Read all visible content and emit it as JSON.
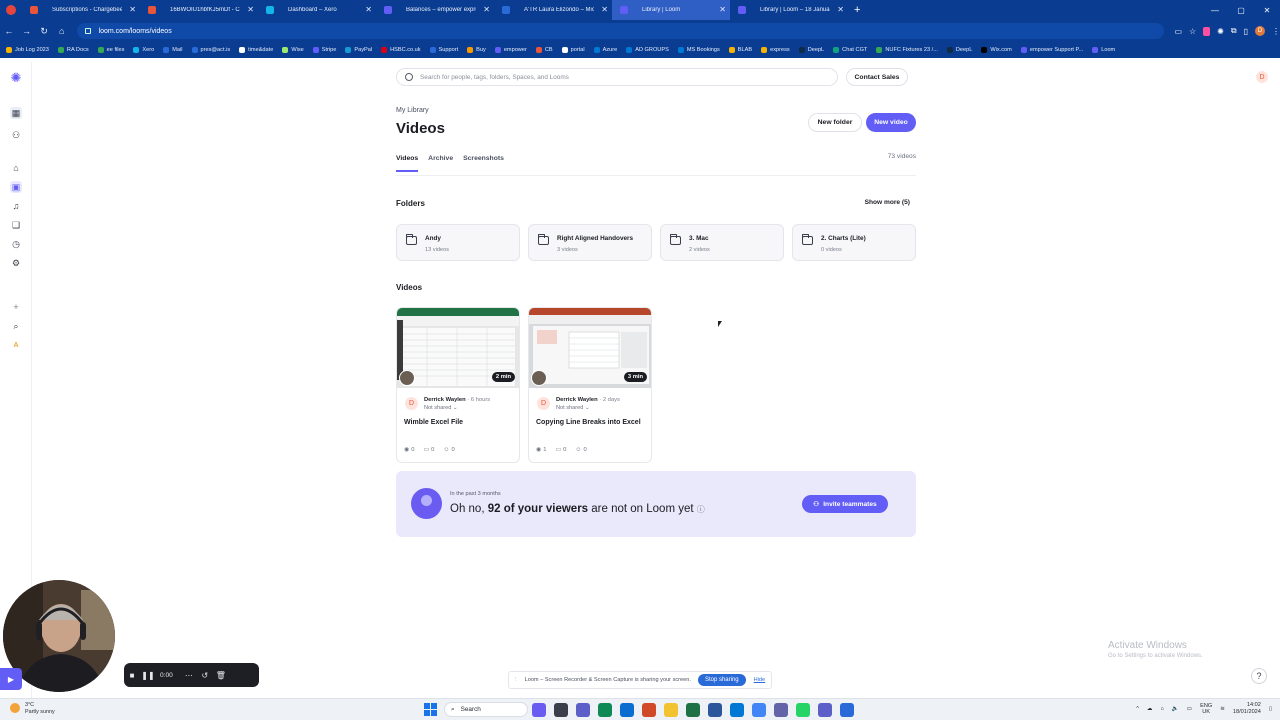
{
  "browser": {
    "tabs": [
      {
        "label": "Subscriptions - Chargebee",
        "color": "#e8553b"
      },
      {
        "label": "16BWOIU1hbfKJ5mDf - Custon",
        "color": "#e8553b"
      },
      {
        "label": "Dashboard – Xero",
        "color": "#13b5ea"
      },
      {
        "label": "Balances – empower express –",
        "color": "#625df5"
      },
      {
        "label": "A'TR Laura Elizondo – Microsoft",
        "color": "#2a6ad8"
      },
      {
        "label": "Library | Loom",
        "color": "#625df5",
        "active": true
      },
      {
        "label": "Library | Loom – 18 January 20",
        "color": "#625df5"
      }
    ],
    "url": "loom.com/looms/videos",
    "bookmarks": [
      {
        "label": "Job Log 2023",
        "color": "#f4b400"
      },
      {
        "label": "RA Docs",
        "color": "#34a853"
      },
      {
        "label": "ee files",
        "color": "#34a853"
      },
      {
        "label": "Xero",
        "color": "#13b5ea"
      },
      {
        "label": "Mail",
        "color": "#2a6ad8"
      },
      {
        "label": "pres@act.is",
        "color": "#2a6ad8"
      },
      {
        "label": "time&date",
        "color": "#ffffff"
      },
      {
        "label": "Wise",
        "color": "#9fe870"
      },
      {
        "label": "Stripe",
        "color": "#635bff"
      },
      {
        "label": "PayPal",
        "color": "#169bd7"
      },
      {
        "label": "HSBC.co.uk",
        "color": "#db0011"
      },
      {
        "label": "Support",
        "color": "#2a6ad8"
      },
      {
        "label": "Buy",
        "color": "#ff9900"
      },
      {
        "label": "empower",
        "color": "#625df5"
      },
      {
        "label": "CB",
        "color": "#e8553b"
      },
      {
        "label": "portal",
        "color": "#ffffff"
      },
      {
        "label": "Azure",
        "color": "#0078d4"
      },
      {
        "label": "AD GROUPS",
        "color": "#0078d4"
      },
      {
        "label": "MS Bookings",
        "color": "#0078d4"
      },
      {
        "label": "BLAB",
        "color": "#f4b400"
      },
      {
        "label": "express",
        "color": "#f4b400"
      },
      {
        "label": "DeepL",
        "color": "#0f2b46"
      },
      {
        "label": "Chat CGT",
        "color": "#10a37f"
      },
      {
        "label": "NUFC Fixtures 23 /...",
        "color": "#34a853"
      },
      {
        "label": "DeepL",
        "color": "#0f2b46"
      },
      {
        "label": "Wix.com",
        "color": "#000000"
      },
      {
        "label": "empower Support P...",
        "color": "#625df5"
      },
      {
        "label": "Loom",
        "color": "#625df5"
      }
    ]
  },
  "loom": {
    "search_placeholder": "Search for people, tags, folders, Spaces, and Looms",
    "contact_sales": "Contact Sales",
    "avatar_initial": "D",
    "breadcrumb": "My Library",
    "page_title": "Videos",
    "new_folder": "New folder",
    "new_video": "New video",
    "tabs": [
      "Videos",
      "Archive",
      "Screenshots"
    ],
    "video_count": "73 videos",
    "folders_heading": "Folders",
    "show_more": "Show more (5)",
    "folders": [
      {
        "name": "Andy",
        "count": "13 videos"
      },
      {
        "name": "Right Aligned Handovers",
        "count": "3 videos"
      },
      {
        "name": "3. Mac",
        "count": "2 videos"
      },
      {
        "name": "2. Charts (Lite)",
        "count": "0 videos"
      }
    ],
    "videos_heading": "Videos",
    "videos": [
      {
        "duration": "2 min",
        "author": "Derrick Waylen",
        "age": " · 6 hours",
        "share": "Not shared",
        "title": "Wimble Excel File",
        "views": "0",
        "comments": "0",
        "reactions": "0"
      },
      {
        "duration": "3 min",
        "author": "Derrick Waylen",
        "age": " · 2 days",
        "share": "Not shared",
        "title": "Copying Line Breaks into Excel",
        "views": "1",
        "comments": "0",
        "reactions": "0"
      }
    ],
    "banner": {
      "sub": "In the past 3 months",
      "msg_pre": "Oh no, ",
      "msg_bold": "92 of your viewers",
      "msg_post": " are not on Loom yet",
      "button": "Invite teammates"
    }
  },
  "overlay": {
    "activate_title": "Activate Windows",
    "activate_sub": "Go to Settings to activate Windows.",
    "share_text": "Loom – Screen Recorder & Screen Capture is sharing your screen.",
    "stop_sharing": "Stop sharing",
    "hide": "Hide",
    "rec_time": "0:00"
  },
  "taskbar": {
    "temp": "3°C",
    "weather": "Partly sunny",
    "search": "Search",
    "lang1": "ENG",
    "lang2": "UK",
    "time": "14:02",
    "date": "18/01/2024"
  }
}
